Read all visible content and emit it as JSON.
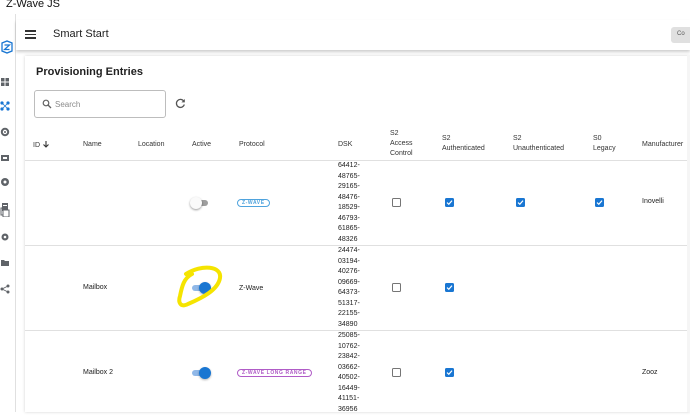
{
  "window": {
    "title": "Z-Wave JS"
  },
  "header": {
    "title": "Smart Start",
    "button_label": "Co"
  },
  "page": {
    "title": "Provisioning Entries"
  },
  "search": {
    "placeholder": "Search"
  },
  "table": {
    "columns": {
      "id": "ID",
      "name": "Name",
      "location": "Location",
      "active": "Active",
      "protocol": "Protocol",
      "dsk": "DSK",
      "s2ac": [
        "S2",
        "Access",
        "Control"
      ],
      "s2auth": [
        "S2",
        "Authenticated"
      ],
      "s2unauth": [
        "S2",
        "Unauthenticated"
      ],
      "s0": [
        "S0",
        "Legacy"
      ],
      "manufacturer": "Manufacturer"
    },
    "rows": [
      {
        "name": "",
        "location": "",
        "active": false,
        "protocol": "Z-WAVE",
        "protocol_style": "chip-zwave",
        "dsk": [
          "64412-",
          "48765-",
          "29165-",
          "48476-",
          "18529-",
          "46793-",
          "61865-",
          "48326"
        ],
        "s2_access_control": false,
        "s2_authenticated": true,
        "s2_unauthenticated": true,
        "s0_legacy": true,
        "manufacturer": "Inovelli"
      },
      {
        "name": "Mailbox",
        "location": "",
        "active": true,
        "protocol": "Z-Wave",
        "protocol_style": "text",
        "dsk": [
          "24474-",
          "03194-",
          "40276-",
          "09669-",
          "64373-",
          "51317-",
          "22155-",
          "34890"
        ],
        "s2_access_control": false,
        "s2_authenticated": true,
        "s2_unauthenticated": null,
        "s0_legacy": null,
        "manufacturer": ""
      },
      {
        "name": "Mailbox 2",
        "location": "",
        "active": true,
        "protocol": "Z-WAVE LONG RANGE",
        "protocol_style": "chip-lr",
        "dsk": [
          "25085-",
          "10762-",
          "23842-",
          "03662-",
          "40502-",
          "16449-",
          "41151-",
          "36956"
        ],
        "s2_access_control": false,
        "s2_authenticated": true,
        "s2_unauthenticated": null,
        "s0_legacy": null,
        "manufacturer": "Zooz"
      }
    ]
  },
  "colors": {
    "accent": "#1976d2",
    "chip_zwave": "#4fa3dd",
    "chip_lr": "#b05cc7",
    "highlight": "#f5e400"
  },
  "icons": [
    "zwave-logo-icon",
    "dashboard-icon",
    "smart-start-icon",
    "settings-icon",
    "scenes-icon",
    "debug-icon",
    "store-icon",
    "copy-icon",
    "gear-icon",
    "folder-icon",
    "share-icon",
    "menu-icon",
    "search-icon",
    "refresh-icon",
    "sort-arrow-icon"
  ]
}
